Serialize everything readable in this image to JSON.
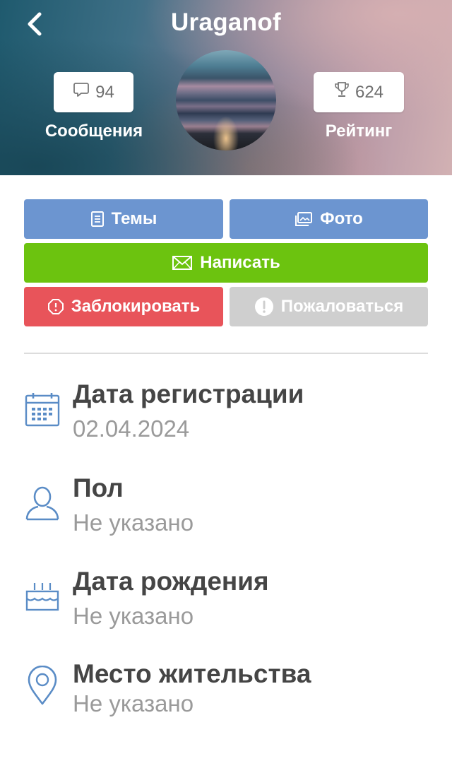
{
  "header": {
    "title": "Uraganof",
    "messages": {
      "count": "94",
      "label": "Сообщения"
    },
    "rating": {
      "count": "624",
      "label": "Рейтинг"
    }
  },
  "actions": {
    "topics": "Темы",
    "photo": "Фото",
    "write": "Написать",
    "block": "Заблокировать",
    "report": "Пожаловаться"
  },
  "info": {
    "registration": {
      "title": "Дата регистрации",
      "value": "02.04.2024"
    },
    "gender": {
      "title": "Пол",
      "value": "Не указано"
    },
    "birthday": {
      "title": "Дата рождения",
      "value": "Не указано"
    },
    "location": {
      "title": "Место жительства",
      "value": "Не указано"
    }
  },
  "colors": {
    "blue_button": "#6c95d0",
    "green_button": "#6cc30f",
    "red_button": "#e8545a",
    "disabled_button": "#cfcfcf",
    "icon_blue": "#5a8cc6"
  },
  "icons": {
    "back": "chevron-left-icon",
    "messages": "chat-bubble-icon",
    "rating": "trophy-icon",
    "topics": "document-icon",
    "photo": "image-icon",
    "write": "envelope-icon",
    "block": "stop-octagon-icon",
    "report": "exclamation-circle-icon",
    "registration": "calendar-icon",
    "gender": "person-icon",
    "birthday": "cake-icon",
    "location": "map-pin-icon"
  }
}
